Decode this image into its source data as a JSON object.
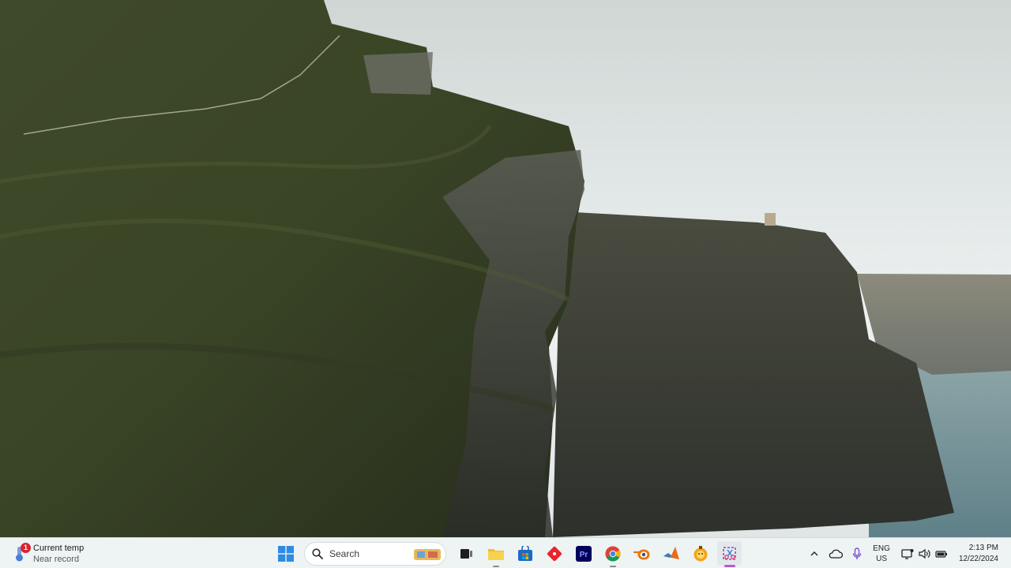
{
  "taskbar": {
    "weather": {
      "title": "Current temp",
      "subtitle": "Near record",
      "badge": "1"
    },
    "search": {
      "label": "Search"
    },
    "apps": [
      {
        "name": "File Explorer"
      },
      {
        "name": "Microsoft Store"
      },
      {
        "name": "Git"
      },
      {
        "name": "Premiere Pro",
        "glyph": "Pr"
      },
      {
        "name": "Google Chrome"
      },
      {
        "name": "Blender"
      },
      {
        "name": "MATLAB"
      },
      {
        "name": "Stickies"
      },
      {
        "name": "Snipping Tool"
      }
    ]
  },
  "tray": {
    "language": {
      "line1": "ENG",
      "line2": "US"
    },
    "clock": {
      "time": "2:13 PM",
      "date": "12/22/2024"
    }
  },
  "colors": {
    "accent": "#b65cc7",
    "taskbar_bg": "#eef3f3",
    "badge": "#d9232f"
  }
}
